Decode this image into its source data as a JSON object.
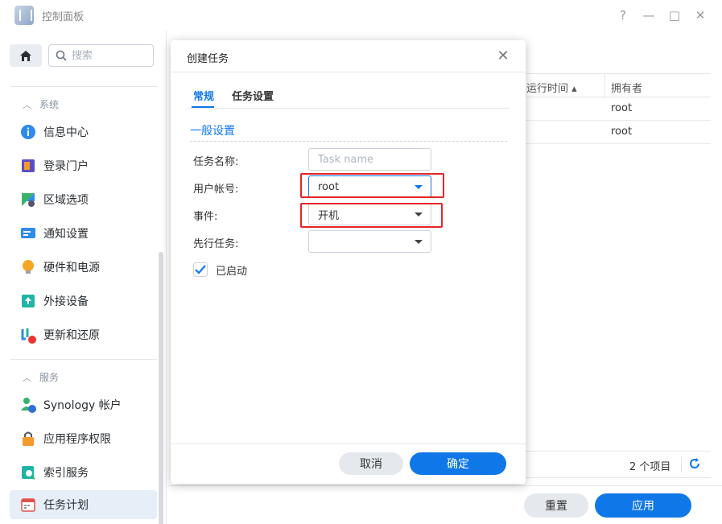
{
  "window": {
    "title": "控制面板",
    "help": "?",
    "minimize": "—",
    "maximize": "□",
    "close": "✕"
  },
  "sidebar": {
    "search_placeholder": "搜索",
    "groups": [
      {
        "label": "系统"
      },
      {
        "label": "服务"
      }
    ],
    "items": [
      {
        "label": "信息中心",
        "icon": "info-icon"
      },
      {
        "label": "登录门户",
        "icon": "login-portal-icon"
      },
      {
        "label": "区域选项",
        "icon": "region-icon"
      },
      {
        "label": "通知设置",
        "icon": "notification-icon"
      },
      {
        "label": "硬件和电源",
        "icon": "hardware-power-icon"
      },
      {
        "label": "外接设备",
        "icon": "external-device-icon"
      },
      {
        "label": "更新和还原",
        "icon": "update-restore-icon"
      },
      {
        "label": "Synology 帐户",
        "icon": "synology-account-icon"
      },
      {
        "label": "应用程序权限",
        "icon": "app-privileges-icon"
      },
      {
        "label": "索引服务",
        "icon": "indexing-icon"
      },
      {
        "label": "任务计划",
        "icon": "task-scheduler-icon",
        "active": true
      }
    ]
  },
  "table": {
    "columns": [
      "运行时间 ▴",
      "拥有者"
    ],
    "rows": [
      {
        "owner": "root"
      },
      {
        "owner": "root"
      }
    ],
    "count": "2 个项目"
  },
  "main_buttons": {
    "reset": "重置",
    "apply": "应用"
  },
  "dialog": {
    "title": "创建任务",
    "tabs": [
      "常规",
      "任务设置"
    ],
    "section": "一般设置",
    "fields": {
      "task_name_label": "任务名称:",
      "task_name_placeholder": "Task name",
      "user_label": "用户帐号:",
      "user_value": "root",
      "event_label": "事件:",
      "event_value": "开机",
      "pre_task_label": "先行任务:",
      "pre_task_value": ""
    },
    "enabled_label": "已启动",
    "enabled": true,
    "cancel": "取消",
    "ok": "确定"
  },
  "colors": {
    "accent": "#0f77e8",
    "highlight_box": "#e3262a"
  }
}
